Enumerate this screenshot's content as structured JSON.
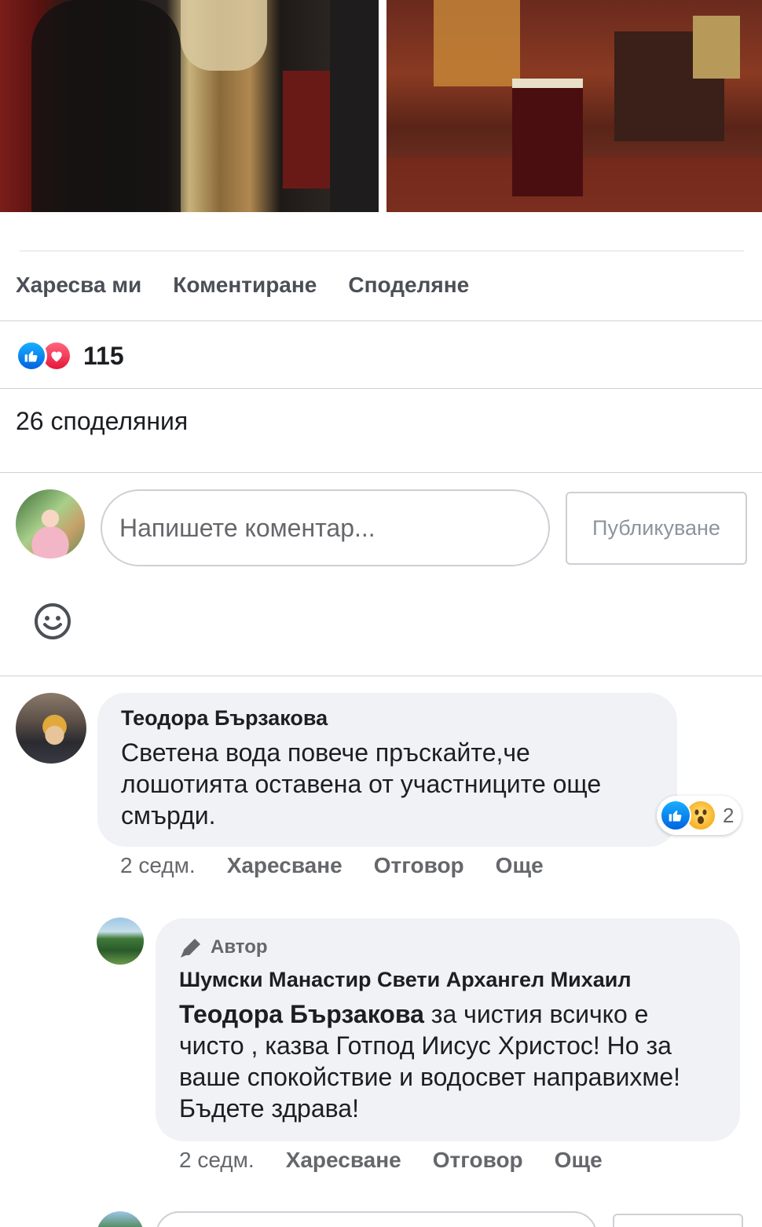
{
  "post": {
    "actions": {
      "like": "Харесва ми",
      "comment": "Коментиране",
      "share": "Споделяне"
    },
    "reactions": {
      "types": [
        "like",
        "love"
      ],
      "count": "115"
    },
    "shares_text": "26 споделяния"
  },
  "composer": {
    "placeholder": "Напишете коментар...",
    "publish_label": "Публикуване"
  },
  "comments": [
    {
      "author": "Теодора Бързакова",
      "text": "Светена вода повече пръскайте,че лошотията оставена от участниците още смърди.",
      "reactions": {
        "types": [
          "like",
          "wow"
        ],
        "count": "2"
      },
      "time": "2 седм.",
      "like_label": "Харесване",
      "reply_label": "Отговор",
      "more_label": "Още"
    }
  ],
  "replies": [
    {
      "badge": "Автор",
      "author": "Шумски Манастир Свети Архангел Михаил",
      "mention": "Теодора Бързакова",
      "text": " за чистия всичко е чисто , казва Готпод Иисус Христос! Но за ваше спокойствие и водосвет направихме! Бъдете здрава!",
      "time": "2 седм.",
      "like_label": "Харесване",
      "reply_label": "Отговор",
      "more_label": "Още"
    }
  ],
  "colors": {
    "accent_like": "#1877f2",
    "love": "#f33e58",
    "bubble": "#f0f2f5",
    "meta_text": "#65676b"
  },
  "icons": {
    "like": "thumbs-up-icon",
    "love": "heart-icon",
    "wow": "wow-face-icon",
    "emoji": "smiley-icon",
    "author_badge": "pencil-icon"
  }
}
